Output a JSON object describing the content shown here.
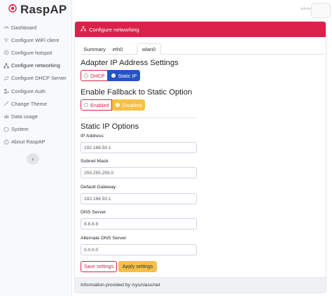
{
  "brand": {
    "name": "RaspAP",
    "logo_icon": "raspap-logo-icon",
    "accent_color": "#d8224c"
  },
  "sidebar": {
    "items": [
      {
        "label": "Dashboard",
        "icon": "dashboard-icon"
      },
      {
        "label": "Configure WiFi client",
        "icon": "wifi-icon"
      },
      {
        "label": "Configure hotspot",
        "icon": "hotspot-icon"
      },
      {
        "label": "Configure networking",
        "icon": "network-icon"
      },
      {
        "label": "Configure DHCP Server",
        "icon": "exchange-icon"
      },
      {
        "label": "Configure Auth",
        "icon": "user-lock-icon"
      },
      {
        "label": "Change Theme",
        "icon": "paint-brush-icon"
      },
      {
        "label": "Data usage",
        "icon": "chart-icon"
      },
      {
        "label": "System",
        "icon": "cube-icon"
      },
      {
        "label": "About RaspAP",
        "icon": "info-icon"
      }
    ],
    "collapse_icon": "chevron-left-icon"
  },
  "topbar": {
    "user_name": "admin"
  },
  "card": {
    "header": "Configure networking",
    "header_icon": "sitemap-icon",
    "tabs": [
      {
        "label": "Summary"
      },
      {
        "label": "eth0"
      },
      {
        "label": "wlan0"
      }
    ],
    "adapter_heading": "Adapter IP Address Settings",
    "adapter_options": {
      "dhcp": "DHCP",
      "static": "Static IP",
      "selected": "Static IP"
    },
    "fallback_heading": "Enable Fallback to Static Option",
    "fallback_options": {
      "enabled": "Enabled",
      "disabled": "Disabled",
      "selected": "Disabled"
    },
    "static_heading": "Static IP Options",
    "fields": [
      {
        "label": "IP Address",
        "value": "192.168.50.1"
      },
      {
        "label": "Subnet Mask",
        "value": "255.255.255.0"
      },
      {
        "label": "Default Gateway",
        "value": "192.168.50.1"
      },
      {
        "label": "DNS Server",
        "value": "8.8.8.8"
      },
      {
        "label": "Alternate DNS Server",
        "value": "0.0.0.0"
      }
    ],
    "save_label": "Save settings",
    "apply_label": "Apply settings",
    "footer": "Information provided by /sys/class/net"
  }
}
